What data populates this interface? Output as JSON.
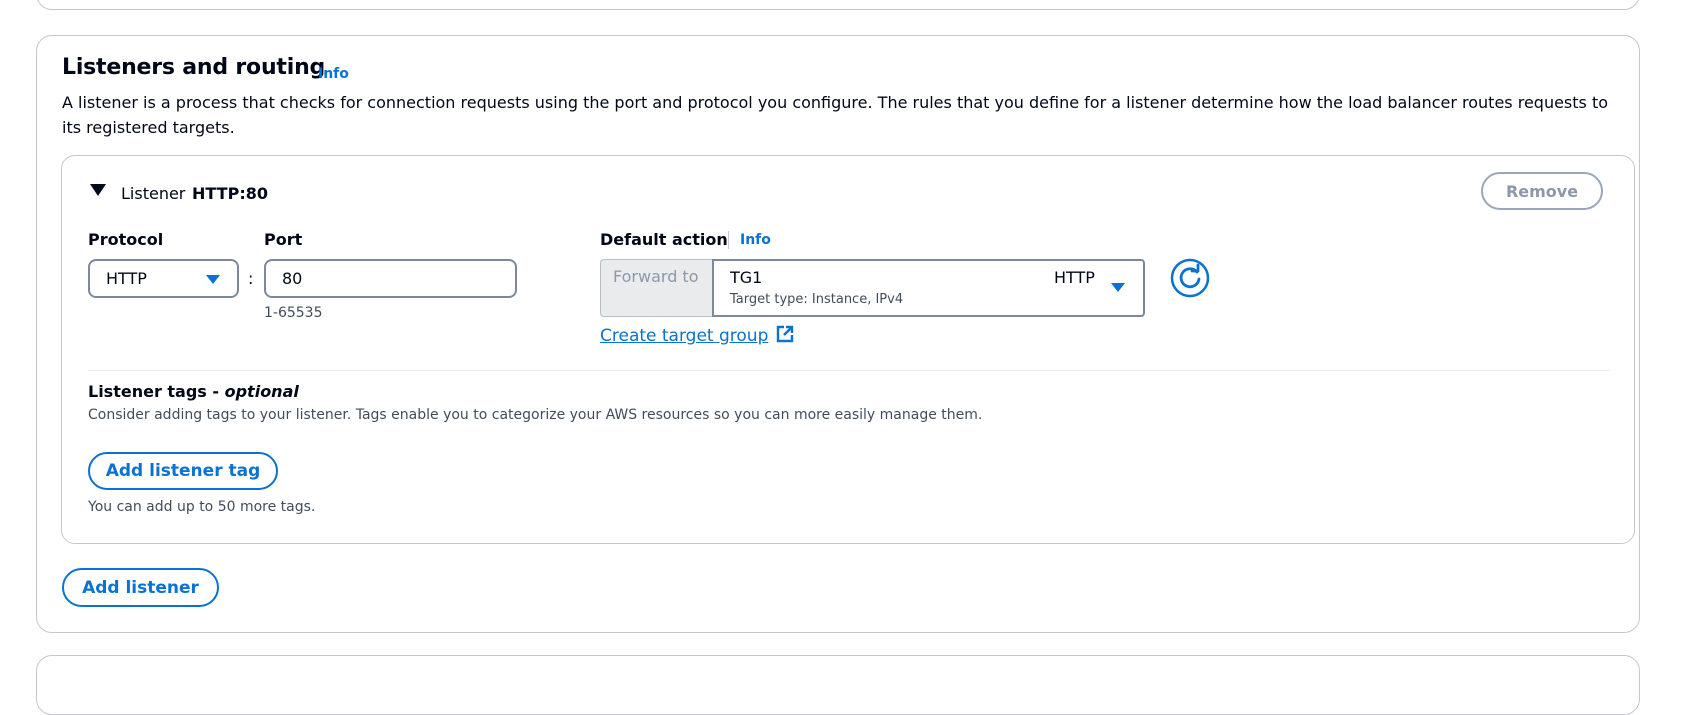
{
  "section": {
    "title": "Listeners and routing",
    "info_label": "Info",
    "description": "A listener is a process that checks for connection requests using the port and protocol you configure. The rules that you define for a listener determine how the load balancer routes requests to its registered targets."
  },
  "listener": {
    "header_prefix": "Listener",
    "header_name": "HTTP:80",
    "remove_label": "Remove",
    "protocol_label": "Protocol",
    "protocol_value": "HTTP",
    "colon": ":",
    "port_label": "Port",
    "port_value": "80",
    "port_hint": "1-65535",
    "default_action_label": "Default action",
    "default_action_info": "Info",
    "forward_to_label": "Forward to",
    "target_group_name": "TG1",
    "target_group_detail": "Target type: Instance, IPv4",
    "target_group_protocol": "HTTP",
    "create_target_group_label": "Create target group",
    "tags_title": "Listener tags - ",
    "tags_optional": "optional",
    "tags_description": "Consider adding tags to your listener. Tags enable you to categorize your AWS resources so you can more easily manage them.",
    "add_tag_label": "Add listener tag",
    "tags_limit_hint": "You can add up to 50 more tags."
  },
  "add_listener_label": "Add listener",
  "colors": {
    "accent": "#0972d3",
    "border": "#7d8998",
    "text": "#000716",
    "muted": "#414d5c"
  },
  "icons": [
    "caret-down-icon",
    "dropdown-caret-icon",
    "refresh-icon",
    "external-link-icon"
  ]
}
